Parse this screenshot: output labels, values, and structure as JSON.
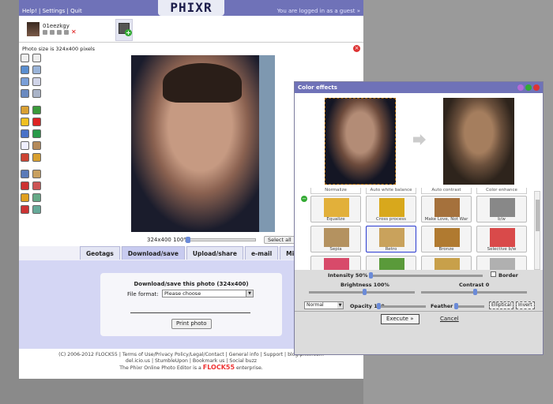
{
  "app": {
    "logo": "PHIXR"
  },
  "topbar": {
    "links": "Help! | Settings | Quit",
    "login": "You are logged in as a guest »"
  },
  "thumb": {
    "name": "01eezkgy"
  },
  "photo": {
    "size_note": "Photo size is 324x400 pixels",
    "size_info": "324x400  100%",
    "select_all": "Select all"
  },
  "tabs": [
    {
      "label": "Geotags"
    },
    {
      "label": "Download/save"
    },
    {
      "label": "Upload/share"
    },
    {
      "label": "e-mail"
    },
    {
      "label": "Misc"
    }
  ],
  "download": {
    "title": "Download/save this photo (324x400)",
    "format_label": "File format:",
    "format_value": "Please choose",
    "print": "Print photo"
  },
  "footer": {
    "line1": "(C) 2006-2012 FLOCK55 | Terms of Use/Privacy Policy/Legal/Contact | General info | Support | blog.phixr.com",
    "line2": "del.icio.us | StumbleUpon | Bookmark us | Social buzz",
    "line3a": "The Phixr Online Photo Editor is a",
    "brand": "FLOCK55",
    "line3b": "enterprise."
  },
  "dialog": {
    "title": "Color effects",
    "top_row": [
      "Normalize",
      "Auto white balance",
      "Auto contrast",
      "Color enhance"
    ],
    "effects": [
      {
        "label": "Equalize",
        "color": "#e2b03a"
      },
      {
        "label": "Cross process",
        "color": "#d8a81c"
      },
      {
        "label": "Make Love, Not War",
        "color": "#a5713c"
      },
      {
        "label": "b/w",
        "color": "#888888"
      },
      {
        "label": "Sepia",
        "color": "#b49260"
      },
      {
        "label": "Retro",
        "color": "#c9a25c"
      },
      {
        "label": "Bronze",
        "color": "#b07a30"
      },
      {
        "label": "Selective b/w",
        "color": "#d94a4a"
      },
      {
        "label": "",
        "color": "#d84a6a"
      },
      {
        "label": "",
        "color": "#5a9a3a"
      },
      {
        "label": "",
        "color": "#c8a04a"
      },
      {
        "label": "",
        "color": "#b0b0b0"
      }
    ],
    "intensity": "Intensity 50%",
    "border": "Border",
    "brightness": "Brightness 100%",
    "contrast": "Contrast 0",
    "blend": "Normal",
    "opacity": "Opacity 100",
    "feather": "Feather 0",
    "elliptical": "Elliptical",
    "invert": "Invert",
    "execute": "Execute »",
    "cancel": "Cancel"
  }
}
